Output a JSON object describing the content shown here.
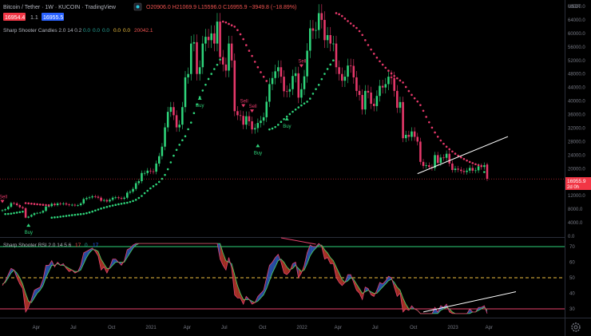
{
  "header": {
    "symbol_title": "Bitcoin / Tether · 1W · KUCOIN · TradingView",
    "ohlc": "O20906.0 H21069.9 L15596.0 C16955.9 −3949.8 (−18.89%)",
    "bid": "16954.4",
    "spread": "1.1",
    "ask": "16955.5",
    "indicator1_name": "Sharp Shooter Candles 2.0 14 0.2",
    "indicator1_values": [
      "0.0",
      "0.0",
      "0.0",
      "0.0",
      "0.0",
      "20042.1"
    ],
    "indicator2_name": "Sharp Shooter RSI 2.0 14 5 6",
    "indicator2_values": [
      "17",
      "0",
      "17"
    ],
    "colors": {
      "up": "#2ed47a",
      "down": "#e6386a",
      "rsi_line": "#e8426d",
      "rsi_signal": "#4cd964",
      "fill_bull": "#2e5bbf",
      "fill_bear": "#c0392b",
      "level_high": "#2ed47a",
      "level_mid": "#f0c040",
      "level_low": "#e8426d",
      "trendline": "#ffffff"
    }
  },
  "price_axis": {
    "currency": "USDT",
    "current_price_label": "16955.9",
    "countdown": "2d 0h",
    "ticks": [
      "0.0",
      "4000.0",
      "8000.0",
      "12000.0",
      "16000.0",
      "20000.0",
      "24000.0",
      "28000.0",
      "32000.0",
      "36000.0",
      "40000.0",
      "44000.0",
      "48000.0",
      "52000.0",
      "56000.0",
      "60000.0",
      "64000.0",
      "68000.0"
    ]
  },
  "rsi_axis": {
    "ticks": [
      "70",
      "60",
      "50",
      "40",
      "30"
    ]
  },
  "time_axis": {
    "ticks": [
      "Apr",
      "Jul",
      "Oct",
      "2021",
      "Apr",
      "Jul",
      "Oct",
      "2022",
      "Apr",
      "Jul",
      "Oct",
      "2023",
      "Apr"
    ]
  },
  "signals": [
    {
      "type": "Sell",
      "week": 0
    },
    {
      "type": "Buy",
      "week": 9
    },
    {
      "type": "Buy",
      "week": 68
    },
    {
      "type": "Buy",
      "week": 88
    },
    {
      "type": "Sell",
      "week": 83
    },
    {
      "type": "Sell",
      "week": 86
    },
    {
      "type": "Buy",
      "week": 98
    },
    {
      "type": "Sell",
      "week": 103
    }
  ],
  "chart_data": [
    {
      "type": "candlestick",
      "title": "Bitcoin / Tether · 1W · KUCOIN",
      "period": "1W",
      "ylabel": "USDT",
      "ylim": [
        0,
        70000
      ],
      "x_start": "2020-01-06",
      "x_step_days": 7,
      "closes": [
        7700,
        8000,
        8700,
        9800,
        9700,
        9200,
        8600,
        8300,
        5500,
        5800,
        6300,
        6800,
        6900,
        7000,
        7500,
        8800,
        8900,
        9600,
        9200,
        9700,
        9500,
        9700,
        9400,
        9200,
        9300,
        9100,
        9200,
        9700,
        11000,
        11300,
        11500,
        11800,
        11700,
        11400,
        10500,
        10700,
        10300,
        10800,
        11400,
        11500,
        11300,
        11100,
        11400,
        12900,
        13200,
        14000,
        15700,
        16300,
        18700,
        18700,
        19400,
        19200,
        19100,
        21500,
        23700,
        26500,
        32200,
        36800,
        38200,
        35800,
        32200,
        33000,
        38200,
        47000,
        48000,
        57000,
        57400,
        48000,
        50000,
        57000,
        59000,
        58000,
        60000,
        57000,
        63500,
        53000,
        50800,
        49000,
        57000,
        52000,
        37000,
        35800,
        35600,
        33000,
        35500,
        34000,
        31600,
        32000,
        33500,
        34200,
        35200,
        39800,
        45000,
        46800,
        48800,
        50000,
        47200,
        42900,
        42800,
        43500,
        47400,
        48200,
        41000,
        43500,
        47300,
        54900,
        61500,
        60800,
        61000,
        66000,
        64000,
        58000,
        59500,
        57000,
        57000,
        50000,
        48000,
        46000,
        47200,
        50500,
        50400,
        47000,
        43000,
        41800,
        37500,
        43000,
        42500,
        39200,
        38500,
        41500,
        44500,
        44000,
        45000,
        47200,
        46800,
        43000,
        38000,
        39700,
        29000,
        30000,
        29400,
        31000,
        29400,
        28000,
        22000,
        20800,
        21000,
        20500,
        20200,
        24000,
        21700,
        23300,
        23200,
        24400,
        21500,
        19600,
        20000,
        19700,
        19300,
        19000,
        19400,
        20200,
        19400,
        19500,
        20700,
        20500,
        21000,
        17000
      ],
      "opens": [
        7500,
        7700,
        8000,
        8700,
        9800,
        9700,
        9200,
        8600,
        8300,
        5500,
        5800,
        6300,
        6800,
        6900,
        7000,
        7500,
        8800,
        8900,
        9600,
        9200,
        9700,
        9500,
        9700,
        9400,
        9200,
        9300,
        9100,
        9200,
        9700,
        11000,
        11300,
        11500,
        11800,
        11700,
        11400,
        10500,
        10700,
        10300,
        10800,
        11400,
        11500,
        11300,
        11100,
        11400,
        12900,
        13200,
        14000,
        15700,
        16300,
        18700,
        18700,
        19400,
        19200,
        19100,
        21500,
        23700,
        26500,
        32200,
        36800,
        38200,
        35800,
        32200,
        33000,
        38200,
        47000,
        48000,
        57000,
        57400,
        48000,
        50000,
        57000,
        59000,
        58000,
        60000,
        57000,
        63500,
        53000,
        50800,
        49000,
        57000,
        52000,
        37000,
        35800,
        35600,
        33000,
        35500,
        34000,
        31600,
        32000,
        33500,
        34200,
        35200,
        39800,
        45000,
        46800,
        48800,
        50000,
        47200,
        42900,
        42800,
        43500,
        47400,
        48200,
        41000,
        43500,
        47300,
        54900,
        61500,
        60800,
        61000,
        66000,
        64000,
        58000,
        59500,
        57000,
        57000,
        50000,
        48000,
        46000,
        47200,
        50500,
        50400,
        47000,
        43000,
        41800,
        37500,
        43000,
        42500,
        39200,
        38500,
        41500,
        44500,
        44000,
        45000,
        47200,
        46800,
        43000,
        38000,
        39700,
        29000,
        30000,
        29400,
        31000,
        29400,
        28000,
        22000,
        20800,
        21000,
        20500,
        20200,
        24000,
        21700,
        23300,
        23200,
        24400,
        21500,
        19600,
        20000,
        19700,
        19300,
        19000,
        19400,
        20200,
        19400,
        19500,
        20700,
        20500,
        20906
      ]
    },
    {
      "type": "line",
      "title": "Sharp Shooter RSI 2.0 14 5 6",
      "ylim": [
        25,
        72
      ],
      "levels": [
        70,
        50,
        30
      ],
      "series": [
        {
          "name": "rsi",
          "values": [
            45,
            48,
            52,
            56,
            55,
            50,
            46,
            43,
            28,
            31,
            36,
            42,
            43,
            44,
            49,
            58,
            58,
            61,
            57,
            60,
            58,
            59,
            56,
            54,
            55,
            53,
            54,
            58,
            66,
            67,
            68,
            69,
            67,
            64,
            55,
            57,
            53,
            57,
            62,
            62,
            60,
            58,
            61,
            68,
            69,
            71,
            74,
            75,
            78,
            77,
            78,
            77,
            76,
            79,
            82,
            84,
            88,
            89,
            88,
            82,
            74,
            74,
            79,
            84,
            84,
            88,
            87,
            72,
            73,
            79,
            80,
            78,
            79,
            75,
            80,
            62,
            58,
            55,
            63,
            56,
            39,
            37,
            37,
            33,
            38,
            36,
            33,
            34,
            38,
            40,
            42,
            50,
            58,
            60,
            63,
            65,
            60,
            53,
            52,
            54,
            59,
            60,
            50,
            53,
            58,
            66,
            71,
            70,
            70,
            73,
            70,
            62,
            63,
            59,
            59,
            50,
            47,
            45,
            47,
            52,
            52,
            47,
            42,
            40,
            36,
            44,
            43,
            39,
            38,
            42,
            47,
            46,
            48,
            51,
            50,
            44,
            38,
            40,
            28,
            30,
            29,
            32,
            30,
            29,
            24,
            23,
            24,
            23,
            23,
            31,
            28,
            32,
            31,
            33,
            28,
            26,
            27,
            27,
            26,
            26,
            27,
            30,
            28,
            28,
            31,
            31,
            32,
            24
          ]
        },
        {
          "name": "signal",
          "values": [
            46,
            47,
            50,
            53,
            55,
            53,
            50,
            46,
            40,
            35,
            34,
            37,
            40,
            42,
            45,
            50,
            54,
            58,
            58,
            59,
            58,
            58,
            57,
            56,
            55,
            54,
            54,
            55,
            59,
            63,
            66,
            68,
            68,
            67,
            62,
            59,
            56,
            56,
            58,
            60,
            60,
            60,
            60,
            63,
            66,
            69,
            71,
            73,
            75,
            76,
            77,
            77,
            77,
            77,
            79,
            81,
            84,
            86,
            88,
            86,
            82,
            78,
            77,
            79,
            81,
            84,
            86,
            82,
            78,
            77,
            78,
            78,
            78,
            77,
            77,
            72,
            66,
            61,
            60,
            59,
            52,
            45,
            40,
            36,
            36,
            36,
            35,
            34,
            35,
            37,
            39,
            43,
            48,
            53,
            57,
            61,
            62,
            60,
            57,
            55,
            56,
            58,
            56,
            54,
            55,
            59,
            64,
            67,
            69,
            71,
            71,
            68,
            66,
            63,
            61,
            57,
            53,
            49,
            47,
            48,
            50,
            49,
            46,
            43,
            40,
            41,
            42,
            41,
            40,
            40,
            42,
            44,
            46,
            48,
            49,
            47,
            44,
            42,
            37,
            33,
            30,
            30,
            30,
            29,
            27,
            25,
            24,
            24,
            23,
            26,
            27,
            29,
            30,
            31,
            30,
            28,
            27,
            27,
            27,
            26,
            26,
            27,
            28,
            28,
            29,
            30,
            31,
            29
          ]
        }
      ]
    }
  ]
}
